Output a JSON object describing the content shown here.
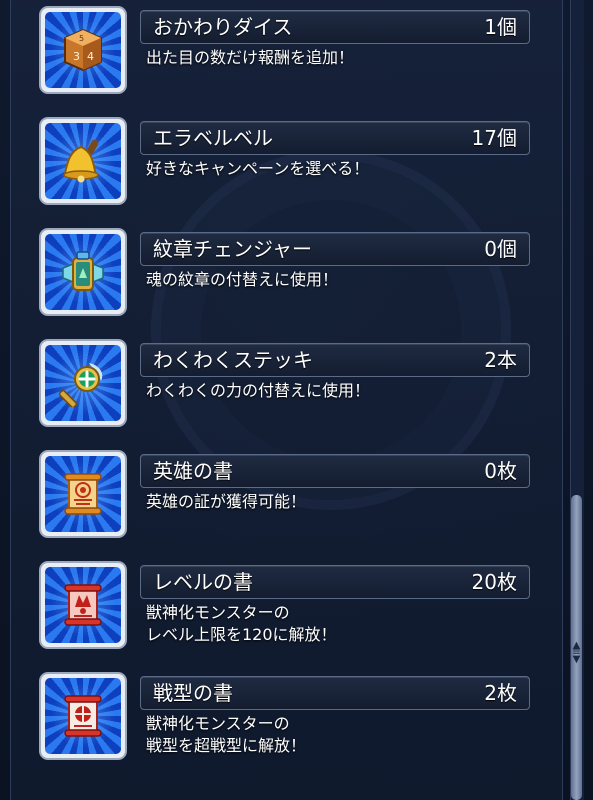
{
  "items": [
    {
      "name": "おかわりダイス",
      "count": "1個",
      "desc": [
        "出た目の数だけ報酬を追加！"
      ],
      "icon": "dice-icon"
    },
    {
      "name": "エラベルベル",
      "count": "17個",
      "desc": [
        "好きなキャンペーンを選べる！"
      ],
      "icon": "bell-icon"
    },
    {
      "name": "紋章チェンジャー",
      "count": "0個",
      "desc": [
        "魂の紋章の付替えに使用！"
      ],
      "icon": "emblem-changer-icon"
    },
    {
      "name": "わくわくステッキ",
      "count": "2本",
      "desc": [
        "わくわくの力の付替えに使用！"
      ],
      "icon": "magic-wand-icon"
    },
    {
      "name": "英雄の書",
      "count": "0枚",
      "desc": [
        "英雄の証が獲得可能！"
      ],
      "icon": "hero-scroll-icon"
    },
    {
      "name": "レベルの書",
      "count": "20枚",
      "desc": [
        "獣神化モンスターの",
        "レベル上限を120に解放！"
      ],
      "icon": "level-scroll-icon"
    },
    {
      "name": "戦型の書",
      "count": "2枚",
      "desc": [
        "獣神化モンスターの",
        "戦型を超戦型に解放！"
      ],
      "icon": "battle-type-scroll-icon"
    }
  ],
  "colors": {
    "background": "#0c1424",
    "icon_blue": "#2a79f0",
    "scroll_red": "#d8342a",
    "text": "#ffffff"
  }
}
